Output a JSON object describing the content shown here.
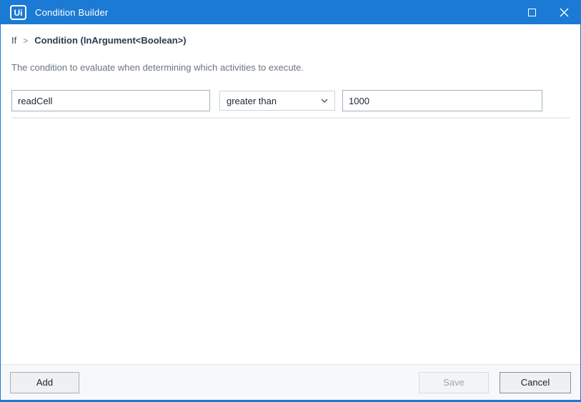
{
  "window": {
    "title": "Condition Builder",
    "logo_text": "Ui",
    "accent_color": "#1b7ad4"
  },
  "titlebar": {
    "icons": {
      "maximize": "maximize-icon",
      "close": "close-icon"
    }
  },
  "breadcrumb": {
    "root": "If",
    "separator": ">",
    "current": "Condition (InArgument<Boolean>)"
  },
  "description": "The condition to evaluate when determining which activities to execute.",
  "condition_row": {
    "left_operand": {
      "value": "readCell",
      "placeholder": ""
    },
    "operator": {
      "selected": "greater than",
      "icon": "chevron-down-icon"
    },
    "right_operand": {
      "value": "1000",
      "placeholder": ""
    }
  },
  "footer": {
    "add_label": "Add",
    "save_label": "Save",
    "cancel_label": "Cancel"
  }
}
